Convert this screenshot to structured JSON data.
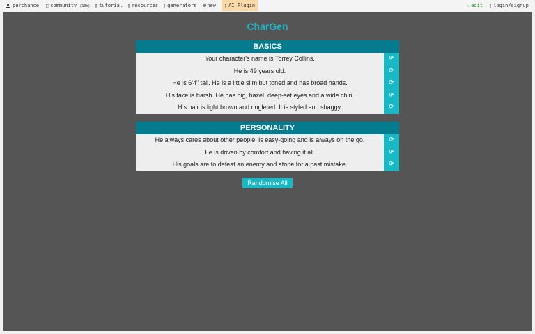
{
  "nav": {
    "brand": "perchance",
    "community": "community",
    "community_count": "(10h)",
    "tutorial": "tutorial",
    "resources": "resources",
    "generators": "generators",
    "new": "new",
    "ai_plugin": "AI Plugin",
    "edit": "edit",
    "login": "login/signup",
    "icons": {
      "community": "□",
      "tutorial": "▯",
      "resources": "▯",
      "generators": "▯",
      "new": "⊕",
      "ai_plugin": "▯",
      "edit": "✏",
      "login": "▯"
    }
  },
  "app": {
    "title": "CharGen",
    "randomise_all": "Randomise All",
    "reroll_icon": "⟳"
  },
  "basics": {
    "heading": "BASICS",
    "rows": [
      "Your character's name is Torrey Collins.",
      "He is 49 years old.",
      "He is 6'4\" tall. He is a little slim but toned and has broad hands.",
      "His face is harsh. He has big, hazel, deep-set eyes and a wide chin.",
      "His hair is light brown and ringleted. It is styled and shaggy."
    ]
  },
  "personality": {
    "heading": "PERSONALITY",
    "rows": [
      "He always cares about other people, is easy-going and is always on the go.",
      "He is driven by comfort and having it all.",
      "His goals are to defeat an enemy and atone for a past mistake."
    ]
  },
  "colors": {
    "accent": "#19b5c7",
    "header": "#047b8f",
    "background": "#555555",
    "row": "#eeeeee"
  }
}
